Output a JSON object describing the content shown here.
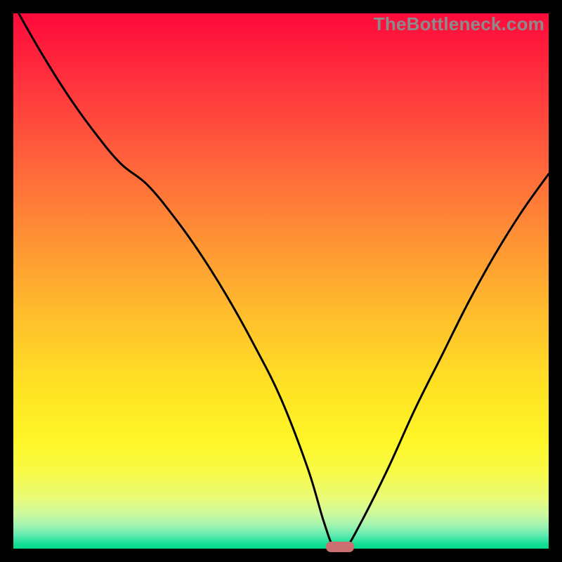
{
  "watermark": "TheBottleneck.com",
  "colors": {
    "black": "#000000",
    "marker": "#cc6f70",
    "curve": "#000000",
    "gradient_stops": [
      {
        "offset": 0.0,
        "color": "#ff0a3b"
      },
      {
        "offset": 0.12,
        "color": "#ff2f3d"
      },
      {
        "offset": 0.25,
        "color": "#ff5a3c"
      },
      {
        "offset": 0.4,
        "color": "#ff8b36"
      },
      {
        "offset": 0.55,
        "color": "#ffba2d"
      },
      {
        "offset": 0.7,
        "color": "#ffe324"
      },
      {
        "offset": 0.8,
        "color": "#fef627"
      },
      {
        "offset": 0.86,
        "color": "#f7fb4a"
      },
      {
        "offset": 0.905,
        "color": "#e9fb77"
      },
      {
        "offset": 0.935,
        "color": "#cdf99d"
      },
      {
        "offset": 0.958,
        "color": "#9df3b0"
      },
      {
        "offset": 0.975,
        "color": "#5eeab0"
      },
      {
        "offset": 0.99,
        "color": "#18df97"
      },
      {
        "offset": 1.0,
        "color": "#00d98b"
      }
    ]
  },
  "chart_data": {
    "type": "line",
    "title": "",
    "xlabel": "",
    "ylabel": "",
    "xlim": [
      0,
      100
    ],
    "ylim": [
      0,
      100
    ],
    "x": [
      1,
      5,
      10,
      15,
      20,
      25,
      30,
      35,
      40,
      45,
      50,
      55,
      58,
      60,
      62,
      65,
      70,
      75,
      80,
      85,
      90,
      95,
      100
    ],
    "values": [
      100,
      93,
      85,
      78,
      72,
      68,
      62,
      55,
      47,
      38,
      28,
      15,
      5,
      0,
      0,
      5,
      15,
      26,
      36,
      46,
      55,
      63,
      70
    ],
    "marker": {
      "x": 61,
      "y": 0
    }
  }
}
